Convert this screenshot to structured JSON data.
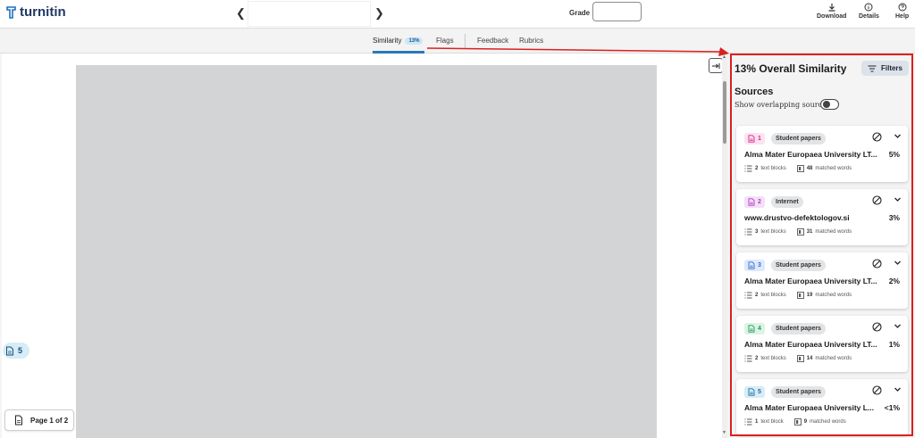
{
  "app": {
    "logo_text": "turnitin"
  },
  "topbar": {
    "grade_label": "Grade",
    "download_label": "Download",
    "details_label": "Details",
    "help_label": "Help"
  },
  "tabs": [
    {
      "label": "Similarity",
      "badge": "13%",
      "active": true
    },
    {
      "label": "Flags",
      "active": false
    },
    {
      "label": "Feedback",
      "active": false
    },
    {
      "label": "Rubrics",
      "active": false
    }
  ],
  "document": {
    "marker_number": "5",
    "page_indicator": "Page 1 of 2"
  },
  "panel": {
    "title": "13% Overall Similarity",
    "filters_label": "Filters",
    "sources_heading": "Sources",
    "overlap_label": "Show overlapping sources",
    "overlap_enabled": false
  },
  "sources": [
    {
      "number": "1",
      "type": "Student papers",
      "name": "Alma Mater Europaea University LT...",
      "percent": "5%",
      "text_blocks": "2",
      "text_blocks_label": "text blocks",
      "matched_words": "48",
      "matched_label": "matched words",
      "color": "#e0248a",
      "bg": "#fbe3f0"
    },
    {
      "number": "2",
      "type": "Internet",
      "name": "www.drustvo-defektologov.si",
      "percent": "3%",
      "text_blocks": "3",
      "text_blocks_label": "text blocks",
      "matched_words": "31",
      "matched_label": "matched words",
      "color": "#b13ac4",
      "bg": "#f3e0f7"
    },
    {
      "number": "3",
      "type": "Student papers",
      "name": "Alma Mater Europaea University LT...",
      "percent": "2%",
      "text_blocks": "2",
      "text_blocks_label": "text blocks",
      "matched_words": "19",
      "matched_label": "matched words",
      "color": "#2f6fd6",
      "bg": "#dfe9fa"
    },
    {
      "number": "4",
      "type": "Student papers",
      "name": "Alma Mater Europaea University LT...",
      "percent": "1%",
      "text_blocks": "2",
      "text_blocks_label": "text blocks",
      "matched_words": "14",
      "matched_label": "matched words",
      "color": "#1e9a55",
      "bg": "#dcf3e5"
    },
    {
      "number": "5",
      "type": "Student papers",
      "name": "Alma Mater Europaea University L...",
      "percent": "<1%",
      "text_blocks": "1",
      "text_blocks_label": "text block",
      "matched_words": "9",
      "matched_label": "matched words",
      "color": "#1d6fa3",
      "bg": "#d6ecf7"
    }
  ]
}
